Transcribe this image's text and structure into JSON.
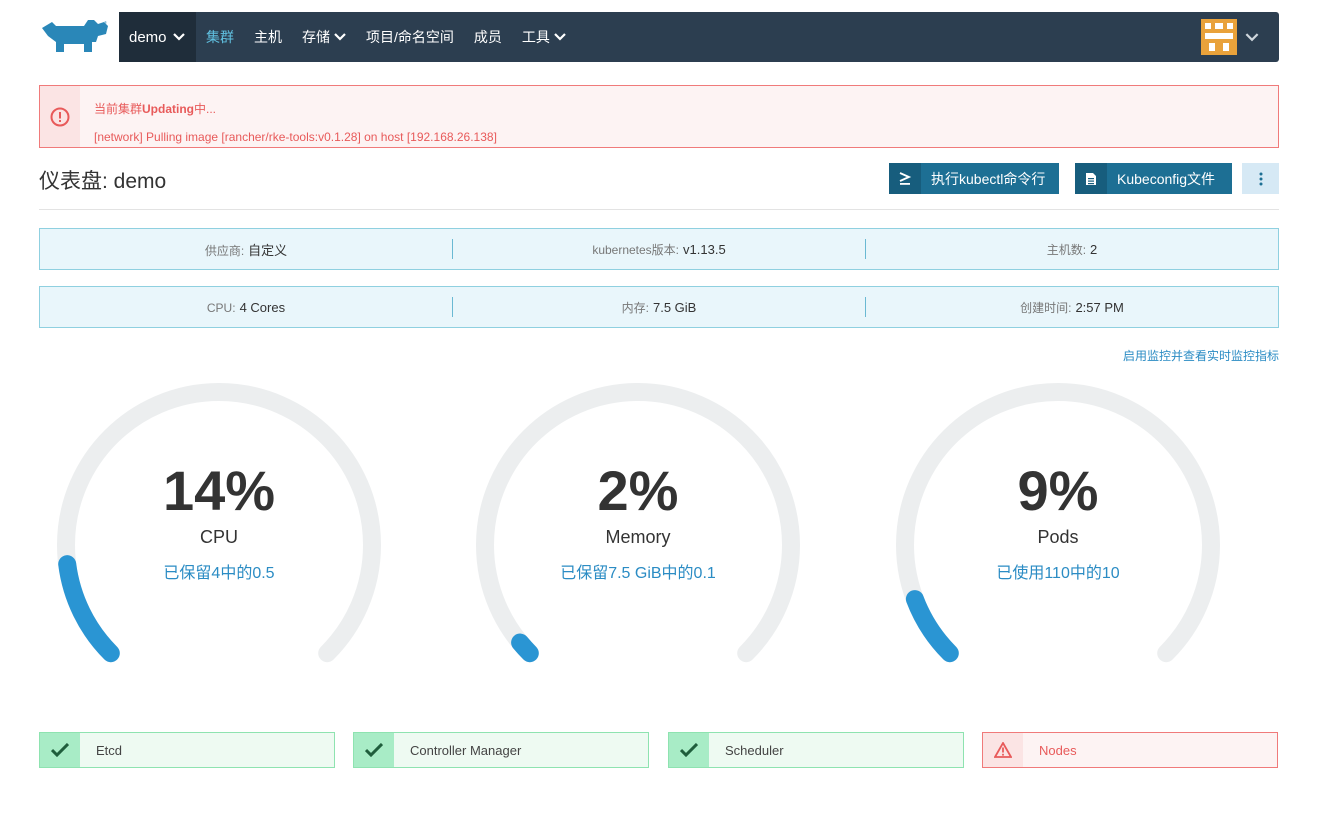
{
  "nav": {
    "cluster": "demo",
    "items": [
      {
        "label": "集群",
        "active": true,
        "dropdown": false
      },
      {
        "label": "主机",
        "active": false,
        "dropdown": false
      },
      {
        "label": "存储",
        "active": false,
        "dropdown": true
      },
      {
        "label": "项目/命名空间",
        "active": false,
        "dropdown": false
      },
      {
        "label": "成员",
        "active": false,
        "dropdown": false
      },
      {
        "label": "工具",
        "active": false,
        "dropdown": true
      }
    ]
  },
  "alert": {
    "prefix": "当前集群",
    "state": "Updating",
    "suffix": "中...",
    "detail": "[network] Pulling image [rancher/rke-tools:v0.1.28] on host [192.168.26.138]"
  },
  "header": {
    "title": "仪表盘: demo",
    "kubectl_label": "执行kubectl命令行",
    "kubeconfig_label": "Kubeconfig文件"
  },
  "info": {
    "row1": [
      {
        "key": "供应商:",
        "value": "自定义"
      },
      {
        "key": "kubernetes版本:",
        "value": "v1.13.5"
      },
      {
        "key": "主机数:",
        "value": "2"
      }
    ],
    "row2": [
      {
        "key": "CPU:",
        "value": "4 Cores"
      },
      {
        "key": "内存:",
        "value": "7.5 GiB"
      },
      {
        "key": "创建时间:",
        "value": "2:57 PM"
      }
    ]
  },
  "monitor_link": "启用监控并查看实时监控指标",
  "gauges": [
    {
      "pct": "14%",
      "name": "CPU",
      "sub": "已保留4中的0.5",
      "fraction": 0.14
    },
    {
      "pct": "2%",
      "name": "Memory",
      "sub": "已保留7.5 GiB中的0.1",
      "fraction": 0.02
    },
    {
      "pct": "9%",
      "name": "Pods",
      "sub": "已使用110中的10",
      "fraction": 0.09
    }
  ],
  "statuses": [
    {
      "label": "Etcd",
      "ok": true
    },
    {
      "label": "Controller Manager",
      "ok": true
    },
    {
      "label": "Scheduler",
      "ok": true
    },
    {
      "label": "Nodes",
      "ok": false
    }
  ],
  "colors": {
    "nav_bg": "#2c3e50",
    "accent": "#2b8cc4",
    "gauge_fill": "#2a95d3",
    "gauge_track": "#eceeef",
    "error": "#e85a5a",
    "ok": "#8ee3b0"
  }
}
